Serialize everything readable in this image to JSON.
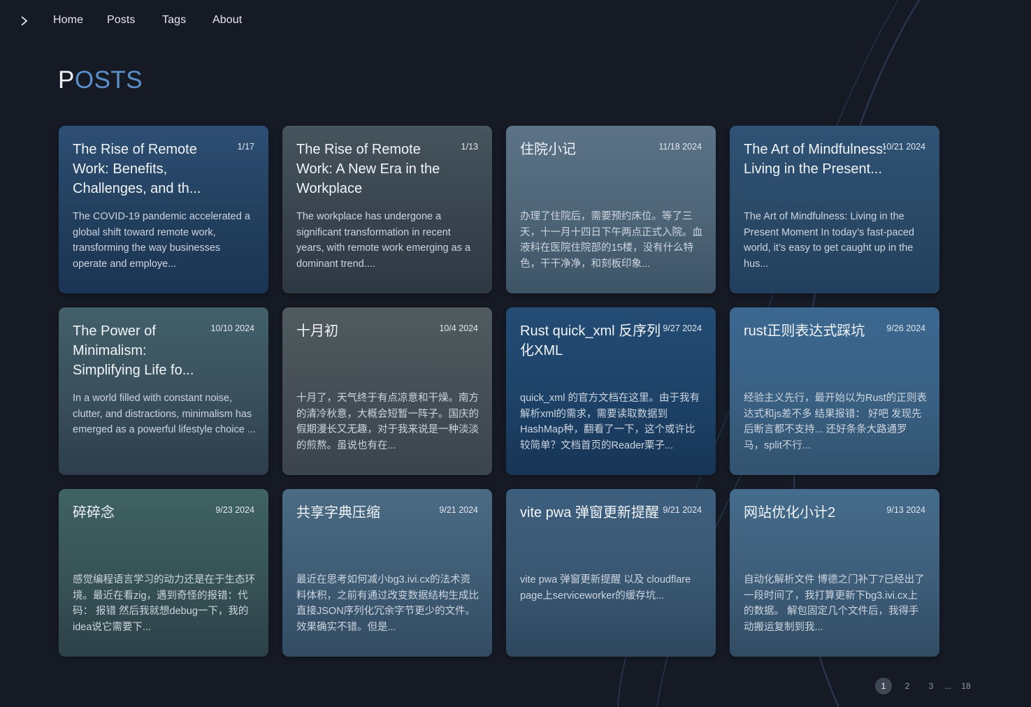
{
  "nav": {
    "toggle_icon": "chevron-right-icon",
    "items": [
      "Home",
      "Posts",
      "Tags",
      "About"
    ]
  },
  "page_title": {
    "first": "P",
    "rest": "OSTS"
  },
  "colors": {
    "background": "#161a24",
    "title_accent": "#5b8fc9",
    "card_text": "#f1f4f8"
  },
  "posts": [
    {
      "title": "The Rise of Remote Work: Benefits, Challenges, and th...",
      "date": "1/17",
      "excerpt": "The COVID-19 pandemic accelerated a global shift toward remote work, transforming the way businesses operate and employe..."
    },
    {
      "title": "The Rise of Remote Work: A New Era in the Workplace",
      "date": "1/13",
      "excerpt": "The workplace has undergone a significant transformation in recent years, with remote work emerging as a dominant trend...."
    },
    {
      "title": "住院小记",
      "date": "11/18 2024",
      "excerpt": "办理了住院后，需要预约床位。等了三天，十一月十四日下午两点正式入院。血液科在医院住院部的15楼，没有什么特色，干干净净，和刻板印象..."
    },
    {
      "title": "The Art of Mindfulness: Living in the Present...",
      "date": "10/21 2024",
      "excerpt": "The Art of Mindfulness: Living in the Present Moment In today’s fast-paced world, it’s easy to get caught up in the hus..."
    },
    {
      "title": "The Power of Minimalism: Simplifying Life fo...",
      "date": "10/10 2024",
      "excerpt": "In a world filled with constant noise, clutter, and distractions, minimalism has emerged as a powerful lifestyle choice ..."
    },
    {
      "title": "十月初",
      "date": "10/4 2024",
      "excerpt": "十月了，天气终于有点凉意和干燥。南方的清冷秋意，大概会短暂一阵子。国庆的假期漫长又无趣，对于我来说是一种淡淡的煎熬。虽说也有在..."
    },
    {
      "title": "Rust quick_xml 反序列化XML",
      "date": "9/27 2024",
      "excerpt": "quick_xml 的官方文档在这里。由于我有解析xml的需求，需要读取数据到HashMap种，翻看了一下，这个或许比较简单？文档首页的Reader栗子..."
    },
    {
      "title": "rust正则表达式踩坑",
      "date": "9/26 2024",
      "excerpt": "经验主义先行，最开始以为Rust的正则表达式和js差不多 结果报错： 好吧 发现先后断言都不支持... 还好条条大路通罗马，split不行..."
    },
    {
      "title": "碎碎念",
      "date": "9/23 2024",
      "excerpt": "感觉编程语言学习的动力还是在于生态环境。最近在看zig，遇到奇怪的报错：代码： 报错 然后我就想debug一下，我的idea说它需要下..."
    },
    {
      "title": "共享字典压缩",
      "date": "9/21 2024",
      "excerpt": "最近在思考如何减小bg3.ivi.cx的法术资料体积，之前有通过改变数据结构生成比直接JSON序列化冗余字节更少的文件。效果确实不错。但是..."
    },
    {
      "title": "vite pwa 弹窗更新提醒",
      "date": "9/21 2024",
      "excerpt": "vite pwa 弹窗更新提醒 以及 cloudflare page上serviceworker的缓存坑..."
    },
    {
      "title": "网站优化小计2",
      "date": "9/13 2024",
      "excerpt": "自动化解析文件 博德之门补丁7已经出了一段时间了，我打算更新下bg3.ivi.cx上的数据。 解包固定几个文件后，我得手动搬运复制到我..."
    }
  ],
  "pagination": {
    "pages": [
      "1",
      "2",
      "3",
      "...",
      "18"
    ],
    "current": "1"
  }
}
